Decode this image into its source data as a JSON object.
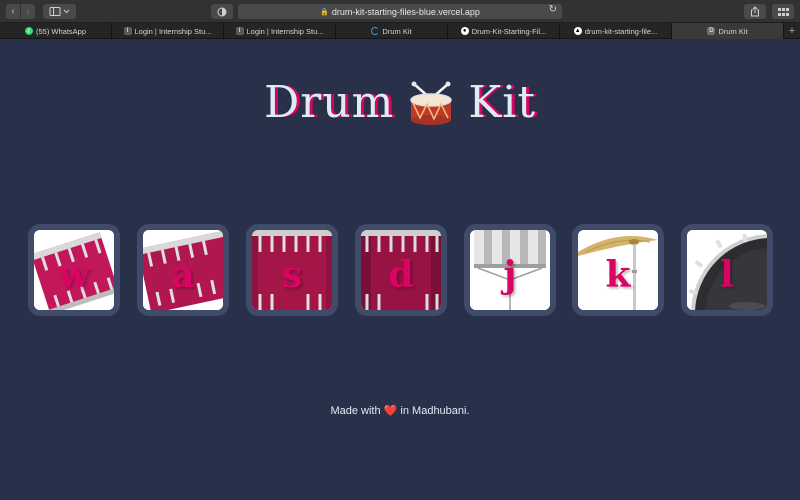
{
  "browser": {
    "url": "drum-kit-starting-files-blue.vercel.app",
    "tabs": [
      {
        "label": "(55) WhatsApp",
        "icon": "whatsapp-icon",
        "color": "#25d366"
      },
      {
        "label": "Login | Internship Stu...",
        "icon": "I",
        "color": "#5a5a5a"
      },
      {
        "label": "Login | Internship Stu...",
        "icon": "I",
        "color": "#5a5a5a"
      },
      {
        "label": "Drum Kit",
        "icon": "loading-icon",
        "color": "#4a90e2"
      },
      {
        "label": "Drum-Kit-Starting-Fil...",
        "icon": "github-icon",
        "color": "#ffffff"
      },
      {
        "label": "drum-kit-starting-file...",
        "icon": "vercel-icon",
        "color": "#ffffff"
      },
      {
        "label": "Drum Kit",
        "icon": "D",
        "color": "#6b6b6b"
      }
    ]
  },
  "page": {
    "title_left": "Drum",
    "title_right": "Kit",
    "keys": [
      {
        "letter": "w"
      },
      {
        "letter": "a"
      },
      {
        "letter": "s"
      },
      {
        "letter": "d"
      },
      {
        "letter": "j"
      },
      {
        "letter": "k"
      },
      {
        "letter": "l"
      }
    ],
    "footer_prefix": "Made with",
    "footer_heart": "❤️",
    "footer_suffix": "in Madhubani."
  },
  "colors": {
    "background": "#283149",
    "key_border": "#404b69",
    "accent": "#da0463",
    "title": "#dbedf3"
  }
}
